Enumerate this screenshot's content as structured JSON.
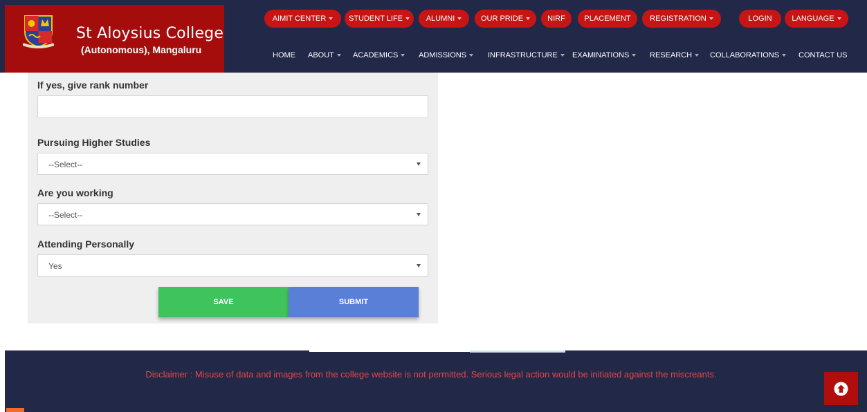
{
  "brand": {
    "title": "St Aloysius College",
    "subtitle": "(Autonomous), Mangaluru",
    "logo_icon": "college-crest-icon"
  },
  "top_nav": [
    {
      "label": "AIMIT CENTER",
      "dropdown": true
    },
    {
      "label": "STUDENT LIFE",
      "dropdown": true
    },
    {
      "label": "ALUMNI",
      "dropdown": true
    },
    {
      "label": "OUR PRIDE",
      "dropdown": true
    },
    {
      "label": "NIRF",
      "dropdown": false
    },
    {
      "label": "PLACEMENT",
      "dropdown": false
    },
    {
      "label": "REGISTRATION",
      "dropdown": true
    },
    {
      "label": "LOGIN",
      "dropdown": false
    },
    {
      "label": "LANGUAGE",
      "dropdown": true
    }
  ],
  "main_nav": [
    {
      "label": "HOME",
      "dropdown": false
    },
    {
      "label": "ABOUT",
      "dropdown": true
    },
    {
      "label": "ACADEMICS",
      "dropdown": true
    },
    {
      "label": "ADMISSIONS",
      "dropdown": true
    },
    {
      "label": "INFRASTRUCTURE",
      "dropdown": true
    },
    {
      "label": "EXAMINATIONS",
      "dropdown": true
    },
    {
      "label": "RESEARCH",
      "dropdown": true
    },
    {
      "label": "COLLABORATIONS",
      "dropdown": true
    },
    {
      "label": "CONTACT US",
      "dropdown": false
    }
  ],
  "form": {
    "rank_label": "If yes, give rank number",
    "rank_value": "",
    "higher_studies_label": "Pursuing Higher Studies",
    "higher_studies_value": "--Select--",
    "working_label": "Are you working",
    "working_value": "--Select--",
    "attending_label": "Attending Personally",
    "attending_value": "Yes",
    "save_label": "SAVE",
    "submit_label": "SUBMIT"
  },
  "footer": {
    "disclaimer": "Disclaimer : Misuse of data and images from the college website is not permitted. Serious legal action would be initiated against the miscreants.",
    "scroll_top_icon": "arrow-up-circle-icon"
  },
  "colors": {
    "header_bg": "#222848",
    "brand_red": "#a50d0d",
    "pill_red": "#c71515",
    "save_green": "#3fc45d",
    "submit_blue": "#5a7fd6",
    "disclaimer_red": "#e04848"
  }
}
